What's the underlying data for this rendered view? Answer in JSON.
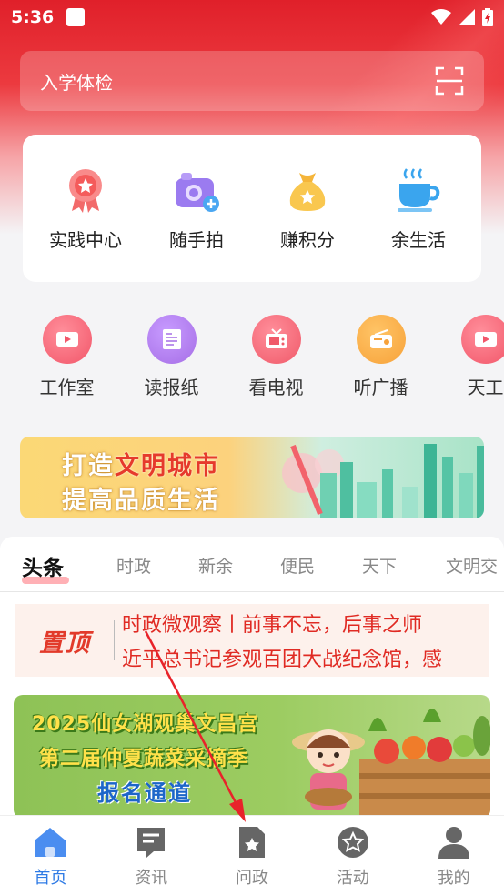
{
  "status_bar": {
    "time": "5:36"
  },
  "search": {
    "placeholder": "入学体检"
  },
  "quick_grid": [
    {
      "label": "实践中心",
      "icon": "medal-icon"
    },
    {
      "label": "随手拍",
      "icon": "camera-icon"
    },
    {
      "label": "赚积分",
      "icon": "money-bag-icon"
    },
    {
      "label": "余生活",
      "icon": "cup-icon"
    }
  ],
  "services": [
    {
      "label": "工作室",
      "icon": "video-icon",
      "color": "#f2576a"
    },
    {
      "label": "读报纸",
      "icon": "newspaper-icon",
      "color": "#a66ee6"
    },
    {
      "label": "看电视",
      "icon": "tv-icon",
      "color": "#f05a6a"
    },
    {
      "label": "听广播",
      "icon": "radio-icon",
      "color": "#f7a23a"
    },
    {
      "label": "天工",
      "icon": "video-icon",
      "color": "#f2576a"
    }
  ],
  "banner": {
    "line1_white": "打造",
    "line1_red": "文明城市",
    "line2": "提高品质生活"
  },
  "news_tabs": [
    "头条",
    "时政",
    "新余",
    "便民",
    "天下",
    "文明交"
  ],
  "pinned": {
    "tag": "置顶",
    "line1": "时政微观察丨前事不忘，后事之师",
    "line2": "近平总书记参观百团大战纪念馆，感"
  },
  "promo": {
    "line1": "2025仙女湖观巢文昌宫",
    "line2": "第二届仲夏蔬菜采摘季",
    "button": "报名通道"
  },
  "bottom_nav": [
    {
      "label": "首页",
      "icon": "home-icon",
      "active": true
    },
    {
      "label": "资讯",
      "icon": "news-icon",
      "active": false
    },
    {
      "label": "问政",
      "icon": "question-doc-icon",
      "active": false
    },
    {
      "label": "活动",
      "icon": "star-badge-icon",
      "active": false
    },
    {
      "label": "我的",
      "icon": "user-icon",
      "active": false
    }
  ],
  "colors": {
    "brand_red": "#e0202a",
    "active_blue": "#2f7be5",
    "arrow_red": "#e8232a"
  }
}
